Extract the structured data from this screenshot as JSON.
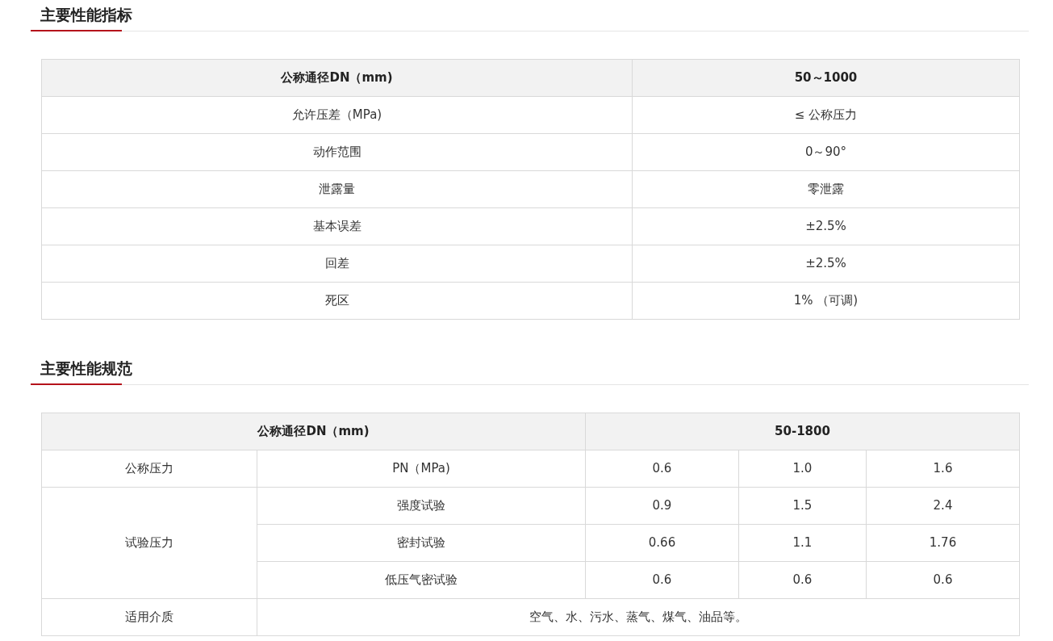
{
  "sections": [
    {
      "title": "主要性能指标",
      "table": {
        "header": [
          {
            "text": "公称通径DN（mm)"
          },
          {
            "text": "50～1000"
          }
        ],
        "rows": [
          [
            {
              "text": "允许压差（MPa)"
            },
            {
              "text": "≤ 公称压力"
            }
          ],
          [
            {
              "text": "动作范围"
            },
            {
              "text": "0～90°"
            }
          ],
          [
            {
              "text": "泄露量"
            },
            {
              "text": "零泄露"
            }
          ],
          [
            {
              "text": "基本误差"
            },
            {
              "text": "±2.5%"
            }
          ],
          [
            {
              "text": "回差"
            },
            {
              "text": "±2.5%"
            }
          ],
          [
            {
              "text": "死区"
            },
            {
              "text": "1% （可调)"
            }
          ]
        ]
      }
    },
    {
      "title": "主要性能规范",
      "table": {
        "header": [
          {
            "text": "公称通径DN（mm)",
            "colspan": 2
          },
          {
            "text": "50-1800",
            "colspan": 3
          }
        ],
        "rows": [
          [
            {
              "text": "公称压力"
            },
            {
              "text": "PN（MPa)"
            },
            {
              "text": "0.6"
            },
            {
              "text": "1.0"
            },
            {
              "text": "1.6"
            }
          ],
          [
            {
              "text": "试验压力",
              "rowspan": 3
            },
            {
              "text": "强度试验"
            },
            {
              "text": "0.9"
            },
            {
              "text": "1.5"
            },
            {
              "text": "2.4"
            }
          ],
          [
            {
              "text": "密封试验"
            },
            {
              "text": "0.66"
            },
            {
              "text": "1.1"
            },
            {
              "text": "1.76"
            }
          ],
          [
            {
              "text": "低压气密试验"
            },
            {
              "text": "0.6"
            },
            {
              "text": "0.6"
            },
            {
              "text": "0.6"
            }
          ],
          [
            {
              "text": "适用介质"
            },
            {
              "text": "空气、水、污水、蒸气、煤气、油品等。",
              "colspan": 4
            }
          ]
        ]
      }
    }
  ]
}
